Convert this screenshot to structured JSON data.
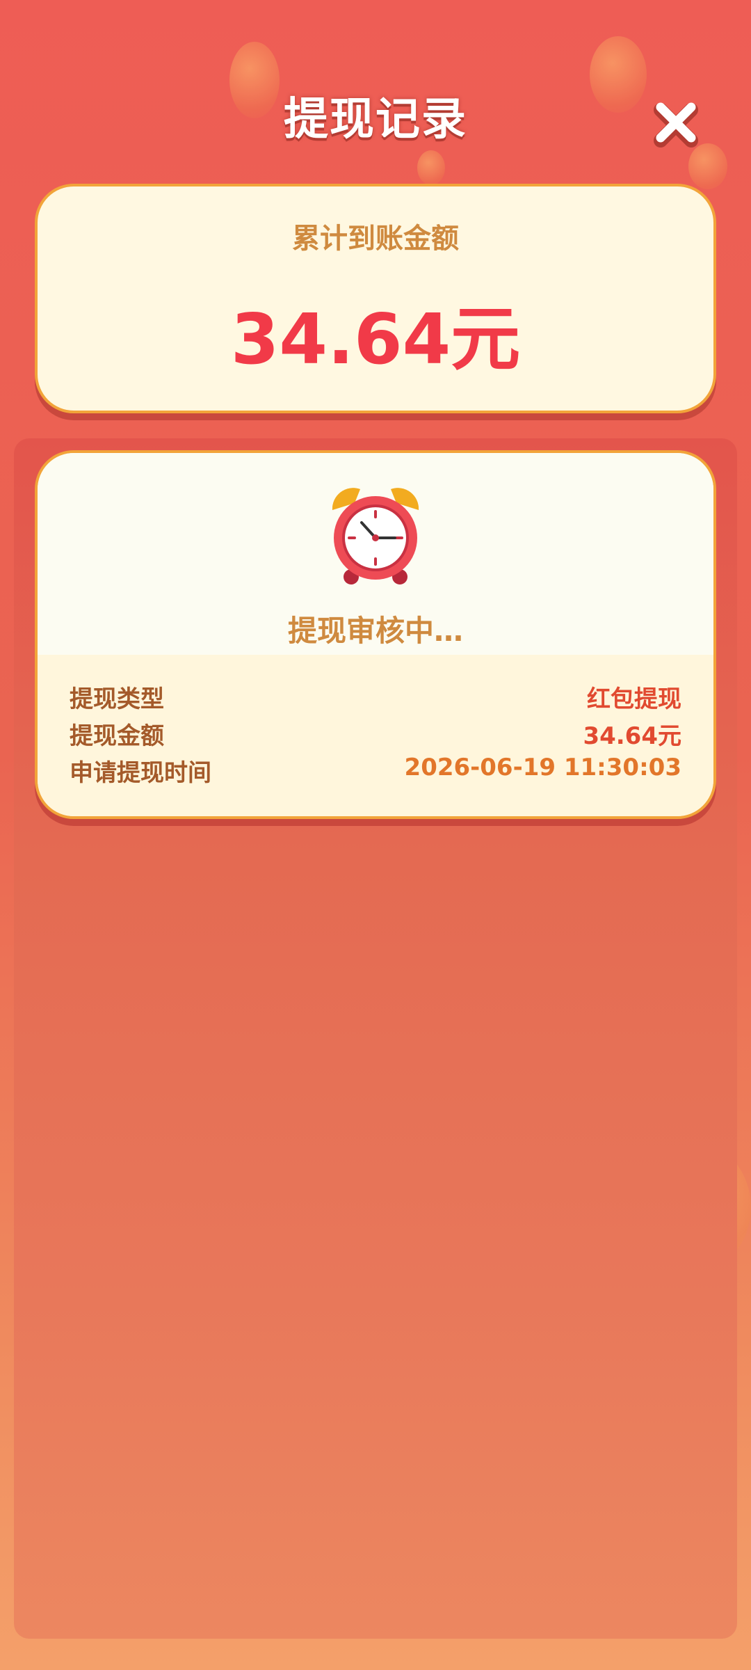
{
  "header": {
    "title": "提现记录",
    "close_icon": "close-icon"
  },
  "summary": {
    "label": "累计到账金额",
    "amount": "34.64元"
  },
  "records": [
    {
      "status_icon": "alarm-clock-icon",
      "status": "提现审核中…",
      "rows": [
        {
          "key": "提现类型",
          "value": "红包提现"
        },
        {
          "key": "提现金额",
          "value": "34.64元"
        },
        {
          "key": "申请提现时间",
          "value": "2026-06-19 11:30:03"
        }
      ]
    }
  ],
  "colors": {
    "background": "#ee5d55",
    "card": "#fff8e1",
    "card_border": "#f2a43a",
    "amount": "#f13a48",
    "label": "#cf8a3f"
  }
}
